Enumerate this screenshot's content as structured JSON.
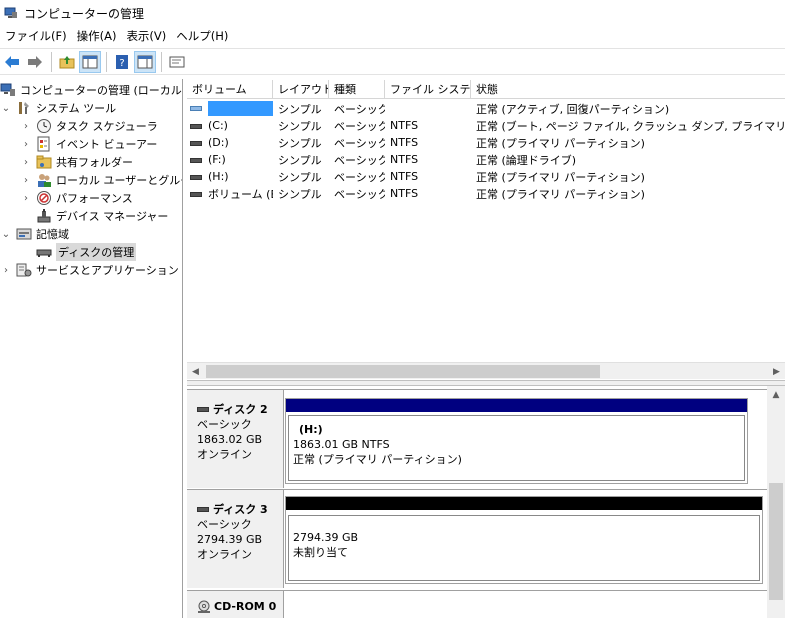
{
  "window": {
    "title": "コンピューターの管理"
  },
  "menu": [
    "ファイル(F)",
    "操作(A)",
    "表示(V)",
    "ヘルプ(H)"
  ],
  "tree": {
    "root": "コンピューターの管理 (ローカル)",
    "system_tools": "システム ツール",
    "task_scheduler": "タスク スケジューラ",
    "event_viewer": "イベント ビューアー",
    "shared_folders": "共有フォルダー",
    "local_users": "ローカル ユーザーとグループ",
    "performance": "パフォーマンス",
    "device_manager": "デバイス マネージャー",
    "storage": "記憶域",
    "disk_management": "ディスクの管理",
    "services_apps": "サービスとアプリケーション"
  },
  "volume_list": {
    "columns": [
      "ボリューム",
      "レイアウト",
      "種類",
      "ファイル システム",
      "状態"
    ],
    "rows": [
      {
        "volume": "",
        "layout": "シンプル",
        "type": "ベーシック",
        "fs": "",
        "status": "正常 (アクティブ, 回復パーティション)"
      },
      {
        "volume": "(C:)",
        "layout": "シンプル",
        "type": "ベーシック",
        "fs": "NTFS",
        "status": "正常 (ブート, ページ ファイル, クラッシュ ダンプ, プライマリ パーティション)"
      },
      {
        "volume": "(D:)",
        "layout": "シンプル",
        "type": "ベーシック",
        "fs": "NTFS",
        "status": "正常 (プライマリ パーティション)"
      },
      {
        "volume": "(F:)",
        "layout": "シンプル",
        "type": "ベーシック",
        "fs": "NTFS",
        "status": "正常 (論理ドライブ)"
      },
      {
        "volume": "(H:)",
        "layout": "シンプル",
        "type": "ベーシック",
        "fs": "NTFS",
        "status": "正常 (プライマリ パーティション)"
      },
      {
        "volume": "ボリューム (E:)",
        "layout": "シンプル",
        "type": "ベーシック",
        "fs": "NTFS",
        "status": "正常 (プライマリ パーティション)"
      }
    ]
  },
  "disks": [
    {
      "name": "ディスク 2",
      "kind": "ベーシック",
      "size": "1863.02 GB",
      "state": "オンライン",
      "partition": {
        "label": "(H:)",
        "detail": "1863.01 GB NTFS",
        "status": "正常 (プライマリ パーティション)",
        "bar_color": "#000080"
      }
    },
    {
      "name": "ディスク 3",
      "kind": "ベーシック",
      "size": "2794.39 GB",
      "state": "オンライン",
      "partition": {
        "label": "",
        "detail": "2794.39 GB",
        "status": "未割り当て",
        "bar_color": "#000000"
      }
    },
    {
      "name": "CD-ROM 0"
    }
  ]
}
